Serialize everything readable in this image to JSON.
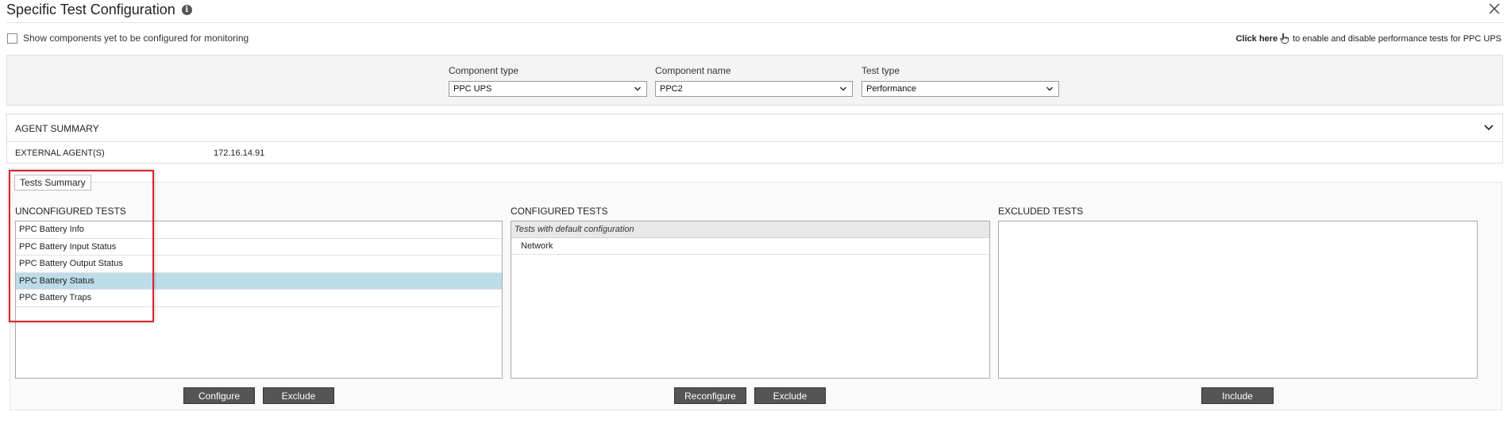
{
  "header": {
    "title": "Specific Test Configuration",
    "info_glyph": "i"
  },
  "options": {
    "show_label": "Show components yet to be configured for monitoring",
    "show_checked": false,
    "click_here_bold": "Click here",
    "click_here_text": "to enable and disable performance tests for PPC UPS"
  },
  "selectors": {
    "component_type": {
      "label": "Component type",
      "value": "PPC UPS"
    },
    "component_name": {
      "label": "Component name",
      "value": "PPC2"
    },
    "test_type": {
      "label": "Test type",
      "value": "Performance"
    }
  },
  "agent_summary": {
    "title": "AGENT SUMMARY",
    "row_label": "EXTERNAL AGENT(S)",
    "row_value": "172.16.14.91"
  },
  "tests_summary": {
    "tab_label": "Tests Summary",
    "unconfigured": {
      "label": "UNCONFIGURED TESTS",
      "items": [
        "PPC Battery Info",
        "PPC Battery Input Status",
        "PPC Battery Output Status",
        "PPC Battery Status",
        "PPC Battery Traps"
      ],
      "selected_index": 3
    },
    "configured": {
      "label": "CONFIGURED TESTS",
      "group_header": "Tests with default configuration",
      "items": [
        "Network"
      ]
    },
    "excluded": {
      "label": "EXCLUDED TESTS",
      "items": []
    },
    "buttons": {
      "configure": "Configure",
      "exclude_left": "Exclude",
      "reconfigure": "Reconfigure",
      "exclude_mid": "Exclude",
      "include": "Include"
    }
  },
  "colors": {
    "selected_row": "#bcdce8",
    "button_bg": "#555555",
    "highlight_border": "#d9242b"
  }
}
